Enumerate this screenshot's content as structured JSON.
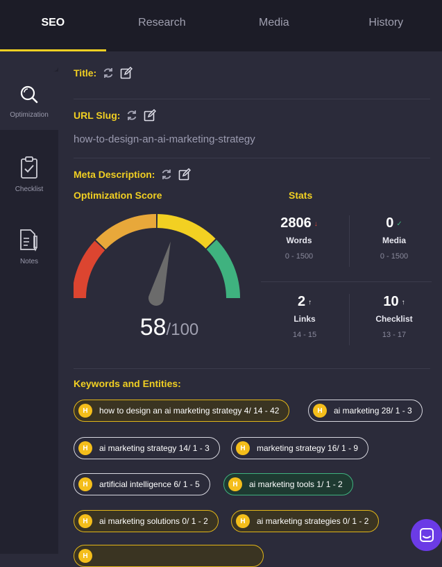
{
  "tabs": [
    {
      "label": "SEO"
    },
    {
      "label": "Research"
    },
    {
      "label": "Media"
    },
    {
      "label": "History"
    }
  ],
  "sidebar": {
    "items": [
      {
        "label": "Optimization",
        "icon": "magnifier-icon"
      },
      {
        "label": "Checklist",
        "icon": "clipboard-check-icon"
      },
      {
        "label": "Notes",
        "icon": "notes-pen-icon"
      }
    ]
  },
  "main": {
    "title_label": "Title:",
    "slug_label": "URL Slug:",
    "slug_value": "how-to-design-an-ai-marketing-strategy",
    "meta_label": "Meta Description:",
    "score_label": "Optimization Score",
    "score_value": "58",
    "score_max": "/100",
    "stats_label": "Stats",
    "keywords_label": "Keywords and Entities:"
  },
  "stats": [
    {
      "num": "2806",
      "arrow": "↓",
      "arrow_color": "#e04a3a",
      "name": "Words",
      "range": "0 - 1500"
    },
    {
      "num": "0",
      "arrow": "✓",
      "arrow_color": "#3fb27f",
      "name": "Media",
      "range": "0 - 1500"
    },
    {
      "num": "2",
      "arrow": "↑",
      "arrow_color": "#ffffff",
      "name": "Links",
      "range": "14 - 15"
    },
    {
      "num": "10",
      "arrow": "↑",
      "arrow_color": "#ffffff",
      "name": "Checklist",
      "range": "13 - 17"
    }
  ],
  "keywords": [
    {
      "text": "how to design an ai marketing strategy 4/ 14 - 42",
      "style": "gold"
    },
    {
      "text": "ai marketing 28/ 1 - 3",
      "style": "plain"
    },
    {
      "text": "ai marketing strategy 14/ 1 - 3",
      "style": "plain"
    },
    {
      "text": "marketing strategy 16/ 1 - 9",
      "style": "plain"
    },
    {
      "text": "artificial intelligence 6/ 1 - 5",
      "style": "plain"
    },
    {
      "text": "ai marketing tools 1/ 1 - 2",
      "style": "green"
    },
    {
      "text": "ai marketing solutions 0/ 1 - 2",
      "style": "gold"
    },
    {
      "text": "ai marketing strategies 0/ 1 - 2",
      "style": "gold"
    }
  ],
  "chips_badge": "H",
  "gauge": {
    "value": 58,
    "max": 100,
    "colors": [
      "#dc4530",
      "#e8a83a",
      "#f2d022",
      "#3fb27f"
    ]
  },
  "colors": {
    "accent": "#f2d022",
    "background": "#2b2b3a",
    "chat": "#6b3be6"
  }
}
